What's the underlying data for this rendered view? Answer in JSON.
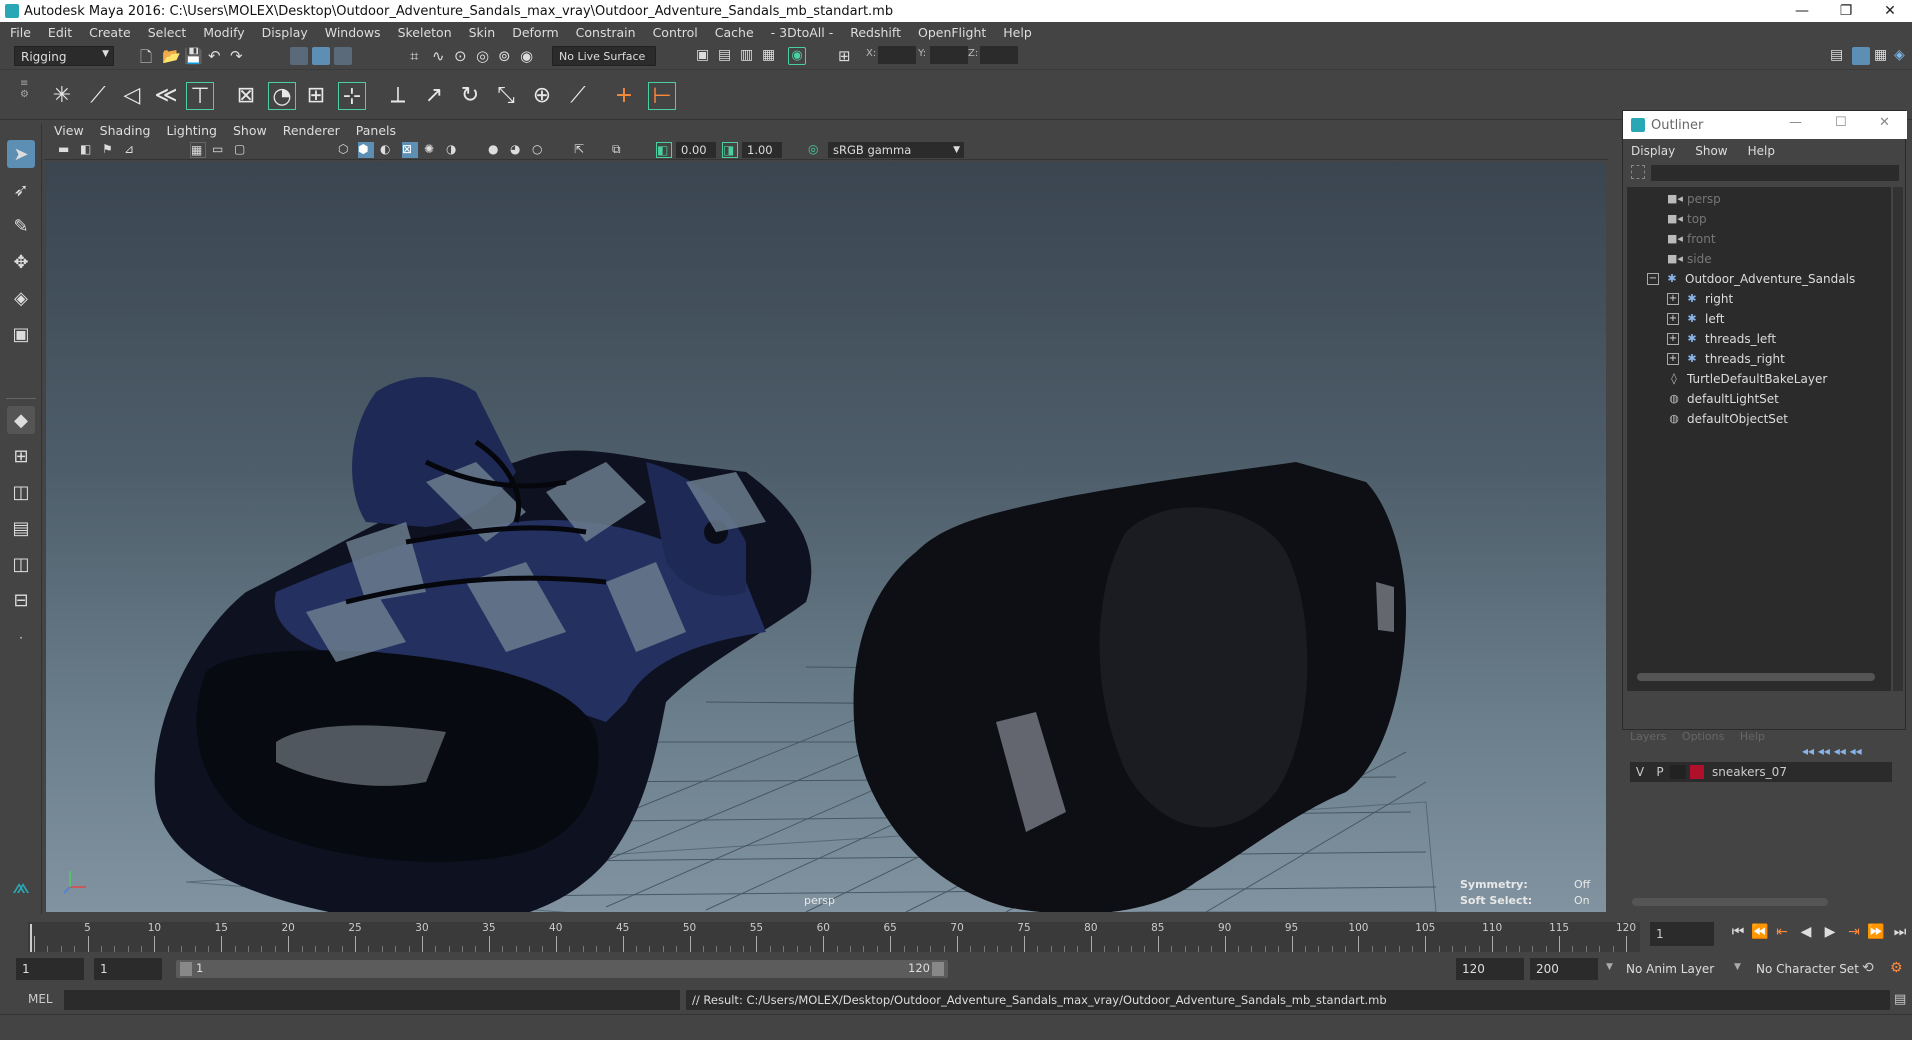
{
  "window": {
    "title": "Autodesk Maya 2016: C:\\Users\\MOLEX\\Desktop\\Outdoor_Adventure_Sandals_max_vray\\Outdoor_Adventure_Sandals_mb_standart.mb",
    "minimize": "—",
    "restore": "❐",
    "close": "✕"
  },
  "menubar": [
    "File",
    "Edit",
    "Create",
    "Select",
    "Modify",
    "Display",
    "Windows",
    "Skeleton",
    "Skin",
    "Deform",
    "Constrain",
    "Control",
    "Cache",
    "- 3DtoAll -",
    "Redshift",
    "OpenFlight",
    "Help"
  ],
  "statusline": {
    "menuset": "Rigging",
    "live_surface": "No Live Surface",
    "x_label": "X:",
    "y_label": "Y:",
    "z_label": "Z:"
  },
  "panel": {
    "menus": [
      "View",
      "Shading",
      "Lighting",
      "Show",
      "Renderer",
      "Panels"
    ],
    "exposure": "0.00",
    "gamma": "1.00",
    "color_space": "sRGB gamma"
  },
  "viewport": {
    "camera_label": "persp",
    "symmetry_label": "Symmetry:",
    "symmetry_value": "Off",
    "soft_select_label": "Soft Select:",
    "soft_select_value": "On"
  },
  "outliner": {
    "title": "Outliner",
    "menus": [
      "Display",
      "Show",
      "Help"
    ],
    "items": [
      {
        "label": "persp",
        "type": "camera",
        "dim": true
      },
      {
        "label": "top",
        "type": "camera",
        "dim": true
      },
      {
        "label": "front",
        "type": "camera",
        "dim": true
      },
      {
        "label": "side",
        "type": "camera",
        "dim": true
      },
      {
        "label": "Outdoor_Adventure_Sandals",
        "type": "group",
        "expanded": true
      },
      {
        "label": "right",
        "type": "group"
      },
      {
        "label": "left",
        "type": "group"
      },
      {
        "label": "threads_left",
        "type": "group"
      },
      {
        "label": "threads_right",
        "type": "group"
      },
      {
        "label": "TurtleDefaultBakeLayer",
        "type": "node"
      },
      {
        "label": "defaultLightSet",
        "type": "set"
      },
      {
        "label": "defaultObjectSet",
        "type": "set"
      }
    ]
  },
  "layers": {
    "tabs": [
      "Layers",
      "Options",
      "Help"
    ],
    "layer": {
      "v": "V",
      "p": "P",
      "name": "sneakers_07",
      "color": "#b0102a"
    }
  },
  "timeline": {
    "ticks": [
      1,
      5,
      10,
      15,
      20,
      25,
      30,
      35,
      40,
      45,
      50,
      55,
      60,
      65,
      70,
      75,
      80,
      85,
      90,
      95,
      100,
      105,
      110,
      115,
      120
    ],
    "current_frame": "1",
    "range_start": "1",
    "playback_start": "1",
    "slider_start": "1",
    "slider_end": "120",
    "playback_end": "120",
    "range_end": "200",
    "anim_layer": "No Anim Layer",
    "character_set": "No Character Set"
  },
  "cmdline": {
    "lang": "MEL",
    "result": "// Result: C:/Users/MOLEX/Desktop/Outdoor_Adventure_Sandals_max_vray/Outdoor_Adventure_Sandals_mb_standart.mb"
  }
}
